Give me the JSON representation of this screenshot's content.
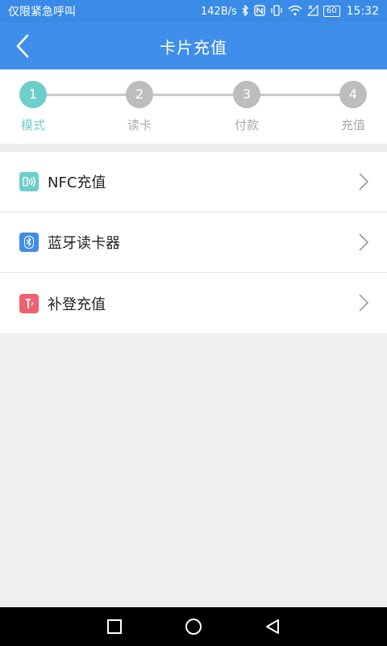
{
  "statusbar": {
    "left_text": "仅限紧急呼叫",
    "net_speed": "142B/s",
    "battery": "60",
    "time": "15:32",
    "icons": [
      "bluetooth-icon",
      "nfc-icon",
      "vibrate-icon",
      "wifi-icon",
      "signal-off-icon",
      "battery-icon"
    ]
  },
  "appbar": {
    "title": "卡片充值",
    "back_icon": "chevron-left-icon"
  },
  "steps": [
    {
      "num": "1",
      "label": "模式",
      "active": true
    },
    {
      "num": "2",
      "label": "读卡",
      "active": false
    },
    {
      "num": "3",
      "label": "付款",
      "active": false
    },
    {
      "num": "4",
      "label": "充值",
      "active": false
    }
  ],
  "menu": [
    {
      "label": "NFC充值",
      "icon": "nfc-icon",
      "color": "#6dcfc9"
    },
    {
      "label": "蓝牙读卡器",
      "icon": "bluetooth-icon",
      "color": "#3f8ee9"
    },
    {
      "label": "补登充值",
      "icon": "card-icon",
      "color": "#f0606e"
    }
  ],
  "colors": {
    "primary": "#3f8ee9",
    "accent": "#6dcfc9",
    "inactive": "#bdbdbd"
  },
  "navbar": {
    "buttons": [
      "recents-square-icon",
      "home-circle-icon",
      "back-triangle-icon"
    ]
  }
}
